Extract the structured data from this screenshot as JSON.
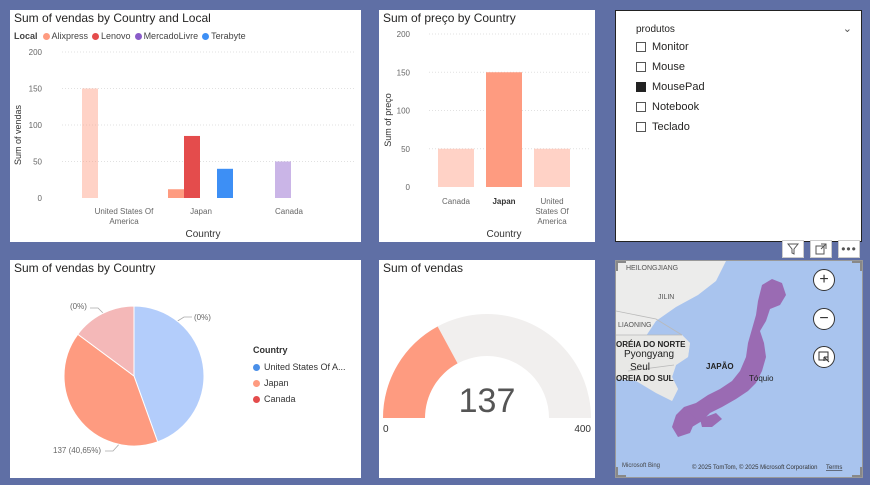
{
  "colors": {
    "alixpress": "#fe9b80",
    "lenovo": "#e44c4c",
    "mercadolivre": "#8a5cc9",
    "terabyte": "#3d8ff5",
    "usa_pie": "#b3cdfb",
    "japan_pie": "#fe9b80",
    "canada_pie": "#f4b8b8",
    "gauge_fill": "#fe9b80",
    "gauge_track": "#f1efee"
  },
  "chart1": {
    "title": "Sum of vendas by Country and Local",
    "legend_title": "Local",
    "legend": [
      "Alixpress",
      "Lenovo",
      "MercadoLivre",
      "Terabyte"
    ],
    "ylabel": "Sum of vendas",
    "xlabel": "Country",
    "yticks": [
      "200",
      "150",
      "100",
      "50",
      "0"
    ],
    "chart_data": {
      "type": "bar",
      "categories": [
        "United States Of America",
        "Japan",
        "Canada"
      ],
      "series": [
        {
          "name": "Alixpress",
          "values": [
            150,
            12,
            null
          ]
        },
        {
          "name": "Lenovo",
          "values": [
            null,
            85,
            null
          ]
        },
        {
          "name": "MercadoLivre",
          "values": [
            null,
            null,
            50
          ]
        },
        {
          "name": "Terabyte",
          "values": [
            null,
            40,
            null
          ]
        }
      ],
      "ylim": [
        0,
        200
      ]
    },
    "cat_labels": [
      "United States Of",
      "America",
      "Japan",
      "Canada"
    ]
  },
  "chart2": {
    "title": "Sum of preço by Country",
    "ylabel": "Sum of preço",
    "xlabel": "Country",
    "yticks": [
      "200",
      "150",
      "100",
      "50",
      "0"
    ],
    "chart_data": {
      "type": "bar",
      "categories": [
        "Canada",
        "Japan",
        "United States Of America"
      ],
      "values": [
        50,
        150,
        50
      ],
      "ylim": [
        0,
        200
      ]
    },
    "cat_labels": [
      "Canada",
      "Japan",
      "United",
      "States Of",
      "America"
    ]
  },
  "slicer": {
    "title": "produtos",
    "items": [
      {
        "label": "Monitor",
        "checked": false
      },
      {
        "label": "Mouse",
        "checked": false
      },
      {
        "label": "MousePad",
        "checked": true
      },
      {
        "label": "Notebook",
        "checked": false
      },
      {
        "label": "Teclado",
        "checked": false
      }
    ]
  },
  "chart3": {
    "title": "Sum of vendas by Country",
    "legend_title": "Country",
    "legend": [
      "United States Of A...",
      "Japan",
      "Canada"
    ],
    "chart_data": {
      "type": "pie",
      "labels": [
        "United States Of America",
        "Japan",
        "Canada"
      ],
      "values": [
        150,
        137,
        50
      ]
    },
    "data_labels": [
      "(0%)",
      "(0%)",
      "137 (40,65%)"
    ]
  },
  "gauge": {
    "title": "Sum of vendas",
    "value": 137,
    "value_text": "137",
    "min": "0",
    "max": "400",
    "min_value": 0,
    "max_value": 400
  },
  "map": {
    "labels": [
      "HEILONGJIANG",
      "JILIN",
      "LIAONING",
      "ORÉIA DO NORTE",
      "Pyongyang",
      "Seul",
      "OREIA DO SUL",
      "JAPÃO",
      "Tóquio"
    ],
    "copyright": "© 2025 TomTom, © 2025 Microsoft Corporation",
    "terms": "Terms",
    "brand": "Microsoft Bing"
  }
}
